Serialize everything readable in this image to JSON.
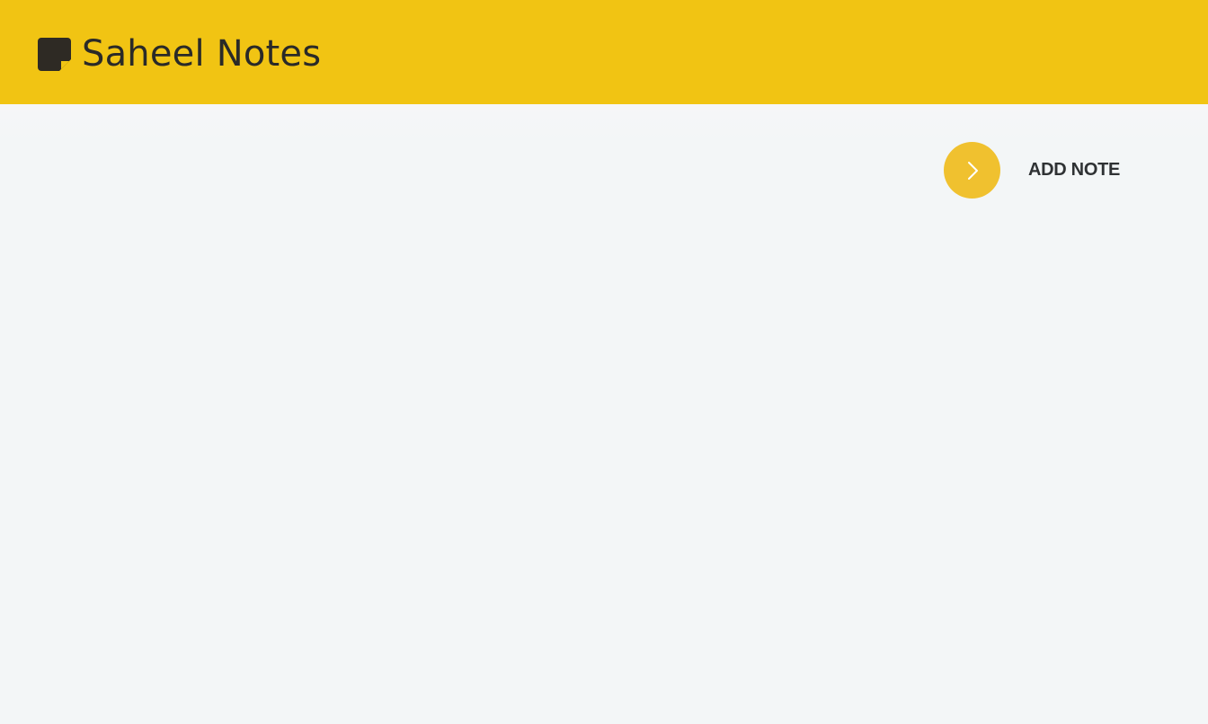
{
  "header": {
    "logo_icon": "sticky-note-icon",
    "title": "Saheel Notes"
  },
  "actions": {
    "add_note_icon": "chevron-right-icon",
    "add_note_label": "ADD NOTE"
  },
  "colors": {
    "header_bg": "#f1c413",
    "accent": "#f0c12f",
    "page_bg": "#f3f6f7",
    "text_dark": "#2a2a28"
  }
}
